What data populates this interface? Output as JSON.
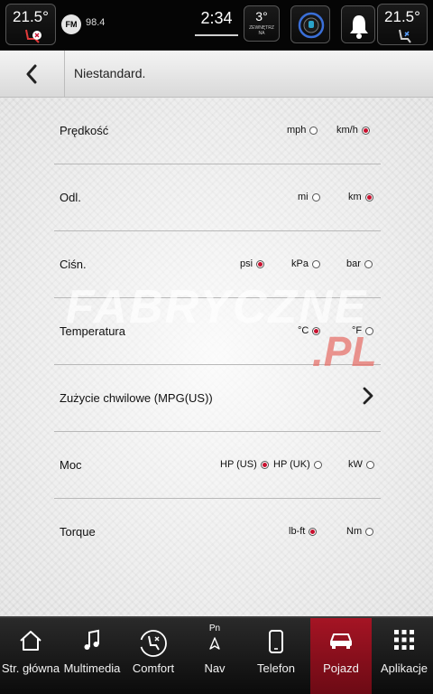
{
  "status": {
    "temp_left": "21.5°",
    "temp_right": "21.5°",
    "radio_badge": "FM",
    "radio_freq": "98.4",
    "clock": "2:34",
    "outside_temp": "3°",
    "outside_label_1": "ZEWNĘTRZ",
    "outside_label_2": "NA"
  },
  "header": {
    "title": "Niestandard."
  },
  "rows": [
    {
      "label": "Prędkość",
      "options": [
        {
          "label": "mph",
          "selected": false
        },
        {
          "label": "km/h",
          "selected": true
        }
      ]
    },
    {
      "label": "Odl.",
      "options": [
        {
          "label": "mi",
          "selected": false
        },
        {
          "label": "km",
          "selected": true
        }
      ]
    },
    {
      "label": "Ciśn.",
      "options": [
        {
          "label": "psi",
          "selected": true
        },
        {
          "label": "kPa",
          "selected": false
        },
        {
          "label": "bar",
          "selected": false
        }
      ]
    },
    {
      "label": "Temperatura",
      "options": [
        {
          "label": "°C",
          "selected": true
        },
        {
          "label": "°F",
          "selected": false
        }
      ]
    },
    {
      "label": "Zużycie chwilowe (MPG(US))"
    },
    {
      "label": "Moc",
      "options": [
        {
          "label": "HP (US)",
          "selected": true
        },
        {
          "label": "HP (UK)",
          "selected": false
        },
        {
          "label": "kW",
          "selected": false
        }
      ]
    },
    {
      "label": "Torque",
      "options": [
        {
          "label": "lb-ft",
          "selected": true
        },
        {
          "label": "Nm",
          "selected": false
        }
      ]
    }
  ],
  "watermark": {
    "text": "FABRYCZNE",
    "suffix": ".PL"
  },
  "nav": [
    {
      "label": "Str. główna",
      "icon": "home-icon"
    },
    {
      "label": "Multimedia",
      "icon": "music-note-icon"
    },
    {
      "label": "Comfort",
      "icon": "comfort-icon"
    },
    {
      "label": "Nav",
      "icon": "navigation-icon",
      "sub": "Pn"
    },
    {
      "label": "Telefon",
      "icon": "phone-icon"
    },
    {
      "label": "Pojazd",
      "icon": "car-icon",
      "active": true
    },
    {
      "label": "Aplikacje",
      "icon": "apps-grid-icon"
    }
  ],
  "colors": {
    "accent": "#c8102e",
    "active_tab": "#a51424"
  }
}
